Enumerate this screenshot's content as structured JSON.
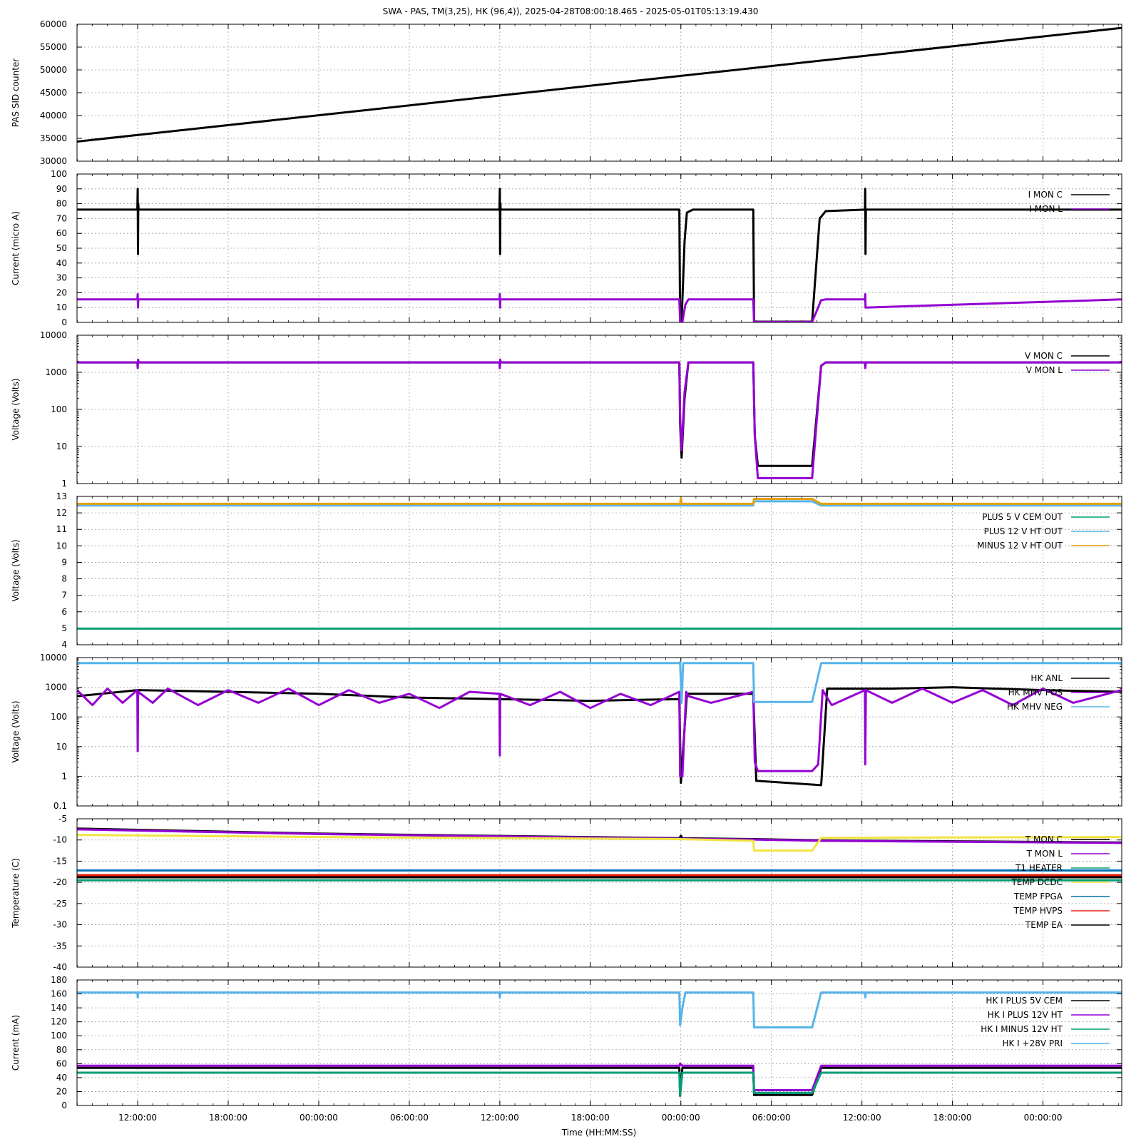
{
  "title": "SWA - PAS, TM(3,25), HK (96,4)),  2025-04-28T08:00:18.465 - 2025-05-01T05:13:19.430",
  "xaxis": {
    "label": "Time (HH:MM:SS)",
    "range_hours": [
      7.98,
      77.22
    ],
    "ticks": [
      {
        "h": 12,
        "label": "12:00:00"
      },
      {
        "h": 18,
        "label": "18:00:00"
      },
      {
        "h": 24,
        "label": "00:00:00"
      },
      {
        "h": 30,
        "label": "06:00:00"
      },
      {
        "h": 36,
        "label": "12:00:00"
      },
      {
        "h": 42,
        "label": "18:00:00"
      },
      {
        "h": 48,
        "label": "00:00:00"
      },
      {
        "h": 54,
        "label": "06:00:00"
      },
      {
        "h": 60,
        "label": "12:00:00"
      },
      {
        "h": 66,
        "label": "18:00:00"
      },
      {
        "h": 72,
        "label": "00:00:00"
      }
    ]
  },
  "chart_data": [
    {
      "type": "line",
      "ylabel": "PAS SID counter",
      "ylim": [
        30000,
        60000
      ],
      "yticks": [
        30000,
        35000,
        40000,
        45000,
        50000,
        55000,
        60000
      ],
      "grid": true,
      "legend": "",
      "series": [
        {
          "color": "#000000",
          "x": [
            7.98,
            77.22
          ],
          "y": [
            34300,
            59200
          ]
        }
      ]
    },
    {
      "type": "line",
      "ylabel": "Current (micro A)",
      "ylim": [
        0,
        100
      ],
      "yticks": [
        0,
        10,
        20,
        30,
        40,
        50,
        60,
        70,
        80,
        90,
        100
      ],
      "grid": true,
      "legend": "top-right",
      "series": [
        {
          "name": "I MON C",
          "color": "#000000",
          "x": [
            7.98,
            11.98,
            12.0,
            12.02,
            12.04,
            12.06,
            35.98,
            36.0,
            36.02,
            36.04,
            36.06,
            47.9,
            47.95,
            48.05,
            48.25,
            48.4,
            48.8,
            52.8,
            52.85,
            56.7,
            57.2,
            57.6,
            60.2,
            60.22,
            60.24,
            60.26,
            77.22
          ],
          "y": [
            76,
            76,
            90,
            46,
            80,
            76,
            76,
            90,
            46,
            80,
            76,
            76,
            1,
            1,
            55,
            74,
            76,
            76,
            0.5,
            0.5,
            70,
            75,
            76,
            90,
            46,
            76,
            76
          ]
        },
        {
          "name": "I MON L",
          "color": "#9400d3",
          "x": [
            7.98,
            11.98,
            12.0,
            12.02,
            12.04,
            35.98,
            36.0,
            36.02,
            36.04,
            47.9,
            47.95,
            48.1,
            48.3,
            48.5,
            52.8,
            52.85,
            56.7,
            57.3,
            57.6,
            60.2,
            60.22,
            60.24,
            77.22
          ],
          "y": [
            15.5,
            15.5,
            19,
            10,
            15.5,
            15.5,
            19,
            10,
            15.5,
            15.5,
            0.3,
            0.3,
            12,
            15.5,
            15.5,
            0.3,
            0.3,
            15,
            15.5,
            15.5,
            19,
            10,
            15.5
          ]
        }
      ]
    },
    {
      "type": "line",
      "ylabel": "Voltage (Volts)",
      "yscale": "log",
      "ylim": [
        1,
        10000
      ],
      "yticks": [
        1,
        10,
        100,
        1000,
        10000
      ],
      "grid": true,
      "legend": "top-right",
      "series": [
        {
          "name": "V MON C",
          "color": "#000000",
          "x": [
            7.98,
            47.9,
            47.95,
            48.05,
            48.25,
            48.5,
            52.8,
            52.9,
            53.1,
            56.7,
            57.3,
            57.6,
            77.22
          ],
          "y": [
            1850,
            1850,
            40,
            5,
            200,
            1850,
            1850,
            20,
            3,
            3,
            1500,
            1850,
            1850
          ]
        },
        {
          "name": "V MON L",
          "color": "#9400d3",
          "x": [
            7.98,
            11.98,
            12.0,
            12.03,
            12.06,
            35.98,
            36.0,
            36.03,
            36.06,
            47.9,
            47.95,
            48.05,
            48.25,
            48.5,
            52.8,
            52.9,
            53.1,
            56.7,
            57.3,
            57.6,
            60.2,
            60.22,
            60.26,
            77.22
          ],
          "y": [
            1850,
            1850,
            1300,
            2200,
            1850,
            1850,
            1300,
            2200,
            1850,
            1850,
            60,
            8,
            300,
            1850,
            1850,
            20,
            1.4,
            1.4,
            1500,
            1850,
            1850,
            1300,
            1850,
            1850
          ]
        }
      ]
    },
    {
      "type": "line",
      "ylabel": "Voltage (Volts)",
      "ylim": [
        4,
        13
      ],
      "yticks": [
        4,
        5,
        6,
        7,
        8,
        9,
        10,
        11,
        12,
        13
      ],
      "grid": true,
      "legend": "top-right",
      "series": [
        {
          "name": "PLUS 5 V CEM OUT",
          "color": "#009e73",
          "x": [
            7.98,
            77.22
          ],
          "y": [
            4.98,
            4.98
          ]
        },
        {
          "name": "PLUS 12 V HT OUT",
          "color": "#56b4e9",
          "x": [
            7.98,
            52.8,
            52.85,
            56.7,
            57.3,
            77.22
          ],
          "y": [
            12.45,
            12.45,
            12.7,
            12.7,
            12.45,
            12.45
          ]
        },
        {
          "name": "MINUS 12 V HT OUT",
          "color": "#e69f00",
          "x": [
            7.98,
            47.95,
            48.0,
            48.05,
            52.8,
            52.85,
            56.7,
            57.3,
            77.22
          ],
          "y": [
            12.55,
            12.55,
            12.9,
            12.55,
            12.55,
            12.85,
            12.85,
            12.55,
            12.55
          ]
        }
      ]
    },
    {
      "type": "line",
      "ylabel": "Voltage (Volts)",
      "yscale": "log",
      "ylim": [
        0.1,
        10000
      ],
      "yticks": [
        0.1,
        1,
        10,
        100,
        1000,
        10000
      ],
      "grid": true,
      "legend": "top-right",
      "series": [
        {
          "name": "HK ANL",
          "color": "#000000",
          "x": [
            7.98,
            12,
            18,
            24,
            30,
            36,
            42,
            47.9,
            48.0,
            48.4,
            52.8,
            53.0,
            57.3,
            57.7,
            62,
            66,
            72,
            77.22
          ],
          "y": [
            500,
            800,
            700,
            600,
            450,
            400,
            350,
            400,
            0.6,
            600,
            600,
            0.7,
            0.5,
            900,
            900,
            1000,
            800,
            700
          ]
        },
        {
          "name": "HK MHV POS",
          "color": "#9400d3",
          "x": [
            7.98,
            9,
            10,
            11,
            11.98,
            12.0,
            12.03,
            13,
            14,
            16,
            18,
            20,
            22,
            24,
            26,
            28,
            30,
            32,
            34,
            35.98,
            36.0,
            36.03,
            38,
            40,
            42,
            44,
            46,
            47.9,
            47.95,
            48.1,
            48.35,
            48.5,
            50,
            52.8,
            52.9,
            53.1,
            56.7,
            57.1,
            57.4,
            58,
            60.2,
            60.22,
            60.26,
            62,
            64,
            66,
            68,
            70,
            72,
            74,
            77.22
          ],
          "y": [
            800,
            250,
            900,
            300,
            800,
            7,
            700,
            300,
            900,
            250,
            800,
            300,
            900,
            250,
            800,
            300,
            600,
            200,
            700,
            600,
            5,
            600,
            250,
            700,
            200,
            600,
            250,
            700,
            1,
            1,
            700,
            500,
            300,
            700,
            3,
            1.5,
            1.5,
            2.5,
            800,
            250,
            800,
            2.5,
            800,
            300,
            900,
            300,
            800,
            250,
            900,
            300,
            800
          ]
        },
        {
          "name": "HK MHV NEG",
          "color": "#56b4e9",
          "x": [
            7.98,
            47.9,
            47.95,
            48.05,
            48.15,
            52.8,
            52.85,
            56.7,
            57.3,
            77.22
          ],
          "y": [
            6500,
            6500,
            7000,
            300,
            6500,
            6500,
            320,
            320,
            6500,
            6500
          ]
        }
      ]
    },
    {
      "type": "line",
      "ylabel": "Temperature (C)",
      "ylim": [
        -40,
        -5
      ],
      "yticks": [
        -40,
        -35,
        -30,
        -25,
        -20,
        -15,
        -10,
        -5
      ],
      "grid": true,
      "legend": "top-right",
      "series": [
        {
          "name": "T MON C",
          "color": "#000000",
          "x": [
            7.98,
            24,
            47.9,
            48.0,
            48.1,
            52.8,
            57.3,
            77.22
          ],
          "y": [
            -7.3,
            -8.5,
            -9.6,
            -9.0,
            -9.6,
            -9.8,
            -10.1,
            -10.6
          ]
        },
        {
          "name": "T MON L",
          "color": "#9400d3",
          "x": [
            7.98,
            24,
            47.9,
            52.8,
            57.3,
            77.22
          ],
          "y": [
            -7.5,
            -8.6,
            -9.7,
            -9.9,
            -10.2,
            -10.7
          ]
        },
        {
          "name": "T1 HEATER",
          "color": "#009e73",
          "x": [
            7.98,
            77.22
          ],
          "y": [
            -19.5,
            -19.5
          ]
        },
        {
          "name": "TEMP DCDC",
          "color": "#f0e442",
          "x": [
            7.98,
            24,
            47.9,
            52.8,
            52.85,
            56.7,
            57.3,
            77.22
          ],
          "y": [
            -8.8,
            -9.3,
            -9.8,
            -10.2,
            -12.5,
            -12.5,
            -9.5,
            -9.3
          ]
        },
        {
          "name": "TEMP FPGA",
          "color": "#0072b2",
          "x": [
            7.98,
            77.22
          ],
          "y": [
            -17.2,
            -17.2
          ]
        },
        {
          "name": "TEMP HVPS",
          "color": "#e51e10",
          "x": [
            7.98,
            77.22
          ],
          "y": [
            -18.3,
            -18.3
          ]
        },
        {
          "name": "TEMP EA",
          "color": "#000000",
          "x": [
            7.98,
            77.22
          ],
          "y": [
            -18.8,
            -18.8
          ]
        }
      ]
    },
    {
      "type": "line",
      "ylabel": "Current (mA)",
      "ylim": [
        0,
        180
      ],
      "yticks": [
        0,
        20,
        40,
        60,
        80,
        100,
        120,
        140,
        160,
        180
      ],
      "grid": true,
      "legend": "top-right",
      "series": [
        {
          "name": "HK I PLUS 5V CEM",
          "color": "#000000",
          "x": [
            7.98,
            47.9,
            47.95,
            48.1,
            52.8,
            52.85,
            56.7,
            57.3,
            77.22
          ],
          "y": [
            54,
            54,
            14,
            54,
            54,
            15,
            15,
            54,
            54
          ]
        },
        {
          "name": "HK I PLUS 12V HT",
          "color": "#9400d3",
          "x": [
            7.98,
            47.9,
            47.95,
            48.1,
            52.8,
            52.85,
            56.7,
            57.3,
            77.22
          ],
          "y": [
            57,
            57,
            60,
            57,
            57,
            22,
            22,
            57,
            57
          ]
        },
        {
          "name": "HK I MINUS 12V HT",
          "color": "#009e73",
          "x": [
            7.98,
            47.9,
            47.95,
            48.1,
            52.8,
            52.85,
            56.7,
            57.3,
            77.22
          ],
          "y": [
            47,
            47,
            15,
            47,
            47,
            18,
            18,
            47,
            47
          ]
        },
        {
          "name": "HK I +28V PRI",
          "color": "#56b4e9",
          "x": [
            7.98,
            11.98,
            12.0,
            12.04,
            35.98,
            36.0,
            36.04,
            47.9,
            47.95,
            48.1,
            48.3,
            52.8,
            52.85,
            56.7,
            57.3,
            60.2,
            60.22,
            60.26,
            77.22
          ],
          "y": [
            162,
            162,
            155,
            162,
            162,
            155,
            162,
            162,
            115,
            140,
            162,
            162,
            112,
            112,
            162,
            162,
            155,
            162,
            162
          ]
        }
      ]
    }
  ]
}
